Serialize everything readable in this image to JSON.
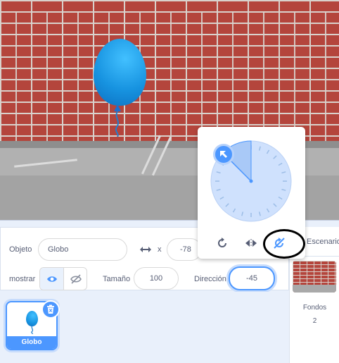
{
  "sprite_info": {
    "sprite_label": "Objeto",
    "sprite_name": "Globo",
    "x_label": "x",
    "x_value": "-78",
    "show_label": "mostrar",
    "size_label": "Tamaño",
    "size_value": "100",
    "direction_label": "Dirección",
    "direction_value": "-45"
  },
  "sprite_list": {
    "items": [
      {
        "name": "Globo"
      }
    ]
  },
  "stage_panel": {
    "header_label": "Escenario",
    "backdrops_label": "Fondos",
    "backdrops_count": "2"
  },
  "direction_popover": {
    "direction_degrees": -45,
    "rotation_styles": [
      "all-around-icon",
      "left-right-icon",
      "dont-rotate-icon"
    ],
    "selected_style": "dont-rotate-icon"
  },
  "colors": {
    "accent": "#4c97ff",
    "dial_fill": "#cfe1fd",
    "brick": "#b4453c"
  }
}
